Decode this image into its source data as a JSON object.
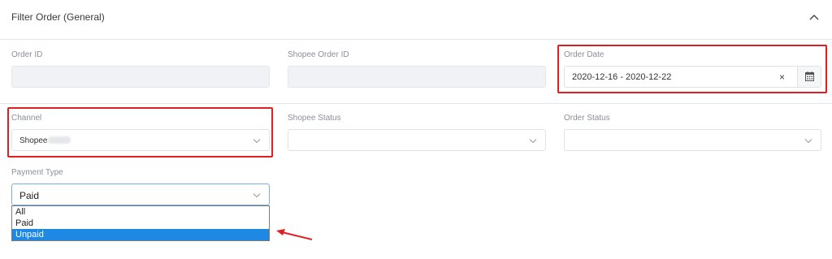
{
  "panel": {
    "title": "Filter Order (General)"
  },
  "fields": {
    "order_id": {
      "label": "Order ID",
      "value": ""
    },
    "shopee_order_id": {
      "label": "Shopee Order ID",
      "value": ""
    },
    "order_date": {
      "label": "Order Date",
      "value": "2020-12-16 - 2020-12-22",
      "clear_glyph": "×"
    },
    "channel": {
      "label": "Channel",
      "value": "Shopee"
    },
    "shopee_status": {
      "label": "Shopee Status",
      "value": ""
    },
    "order_status": {
      "label": "Order Status",
      "value": ""
    },
    "payment_type": {
      "label": "Payment Type",
      "value": "Paid",
      "options": [
        "All",
        "Paid",
        "Unpaid"
      ],
      "highlighted_option": "Unpaid"
    }
  },
  "colors": {
    "highlight_red": "#e02020",
    "selected_blue": "#1e88e5",
    "disabled_bg": "#f0f2f5"
  },
  "icons": {
    "collapse": "chevron-up-icon",
    "select": "chevron-down-icon",
    "calendar": "calendar-icon",
    "clear": "close-icon"
  }
}
